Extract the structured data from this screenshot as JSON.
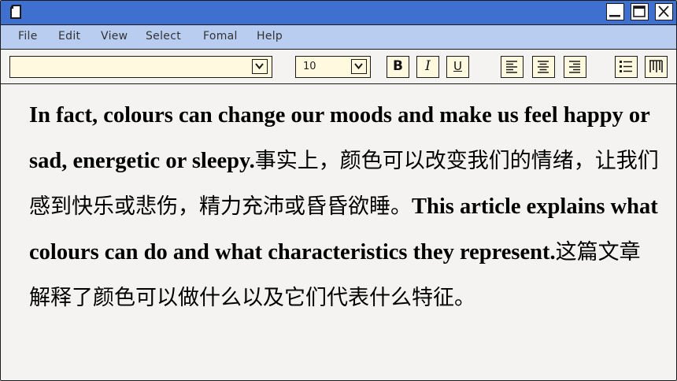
{
  "menu": {
    "file": "File",
    "edit": "Edit",
    "view": "View",
    "select": "Select",
    "format": "Fomal",
    "help": "Help"
  },
  "toolbar": {
    "font_name": "",
    "font_size": "10",
    "bold_label": "B",
    "italic_label": "I",
    "underline_label": "U"
  },
  "document": {
    "seg1": "In fact, colours can change our moods and make us feel happy or sad, energetic or sleepy.",
    "seg2": "事实上，颜色可以改变我们的情绪，让我们感到快乐或悲伤，精力充沛或昏昏欲睡。",
    "seg3": "This article explains what colours can do and what characteristics they represent.",
    "seg4": "这篇文章解释了颜色可以做什么以及它们代表什么特征。"
  },
  "colors": {
    "titlebar": "#3f6fcf",
    "menubar": "#b9cdf1",
    "field": "#fffadf",
    "page": "#f4f3f1"
  }
}
